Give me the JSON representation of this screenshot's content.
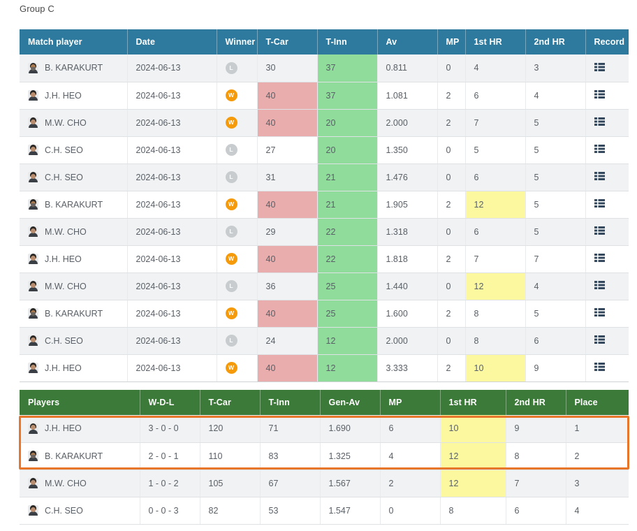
{
  "group_label": "Group C",
  "colors": {
    "match_header_bg": "#2d7a9e",
    "standings_header_bg": "#3b7a38",
    "green_cell": "#8fdc9b",
    "red_cell": "#eaadad",
    "yellow_cell": "#fbf8a0",
    "win_badge": "#f59b0b",
    "loss_badge": "#c8ccce",
    "highlight_border": "#e8762a"
  },
  "match_table": {
    "columns": [
      "Match player",
      "Date",
      "Winner",
      "T-Car",
      "T-Inn",
      "Av",
      "MP",
      "1st HR",
      "2nd HR",
      "Record"
    ],
    "rows": [
      {
        "player": "B. KARAKURT",
        "date": "2024-06-13",
        "winner": "L",
        "t_car": "30",
        "t_inn": "37",
        "av": "0.811",
        "mp": "0",
        "hr1": "4",
        "hr2": "3",
        "record": "record-list-icon"
      },
      {
        "player": "J.H. HEO",
        "date": "2024-06-13",
        "winner": "W",
        "t_car": "40",
        "t_inn": "37",
        "av": "1.081",
        "mp": "2",
        "hr1": "6",
        "hr2": "4",
        "record": "record-list-icon"
      },
      {
        "player": "M.W. CHO",
        "date": "2024-06-13",
        "winner": "W",
        "t_car": "40",
        "t_inn": "20",
        "av": "2.000",
        "mp": "2",
        "hr1": "7",
        "hr2": "5",
        "record": "record-list-icon"
      },
      {
        "player": "C.H. SEO",
        "date": "2024-06-13",
        "winner": "L",
        "t_car": "27",
        "t_inn": "20",
        "av": "1.350",
        "mp": "0",
        "hr1": "5",
        "hr2": "5",
        "record": "record-list-icon"
      },
      {
        "player": "C.H. SEO",
        "date": "2024-06-13",
        "winner": "L",
        "t_car": "31",
        "t_inn": "21",
        "av": "1.476",
        "mp": "0",
        "hr1": "6",
        "hr2": "5",
        "record": "record-list-icon"
      },
      {
        "player": "B. KARAKURT",
        "date": "2024-06-13",
        "winner": "W",
        "t_car": "40",
        "t_inn": "21",
        "av": "1.905",
        "mp": "2",
        "hr1": "12",
        "hr2": "5",
        "record": "record-list-icon"
      },
      {
        "player": "M.W. CHO",
        "date": "2024-06-13",
        "winner": "L",
        "t_car": "29",
        "t_inn": "22",
        "av": "1.318",
        "mp": "0",
        "hr1": "6",
        "hr2": "5",
        "record": "record-list-icon"
      },
      {
        "player": "J.H. HEO",
        "date": "2024-06-13",
        "winner": "W",
        "t_car": "40",
        "t_inn": "22",
        "av": "1.818",
        "mp": "2",
        "hr1": "7",
        "hr2": "7",
        "record": "record-list-icon"
      },
      {
        "player": "M.W. CHO",
        "date": "2024-06-13",
        "winner": "L",
        "t_car": "36",
        "t_inn": "25",
        "av": "1.440",
        "mp": "0",
        "hr1": "12",
        "hr2": "4",
        "record": "record-list-icon"
      },
      {
        "player": "B. KARAKURT",
        "date": "2024-06-13",
        "winner": "W",
        "t_car": "40",
        "t_inn": "25",
        "av": "1.600",
        "mp": "2",
        "hr1": "8",
        "hr2": "5",
        "record": "record-list-icon"
      },
      {
        "player": "C.H. SEO",
        "date": "2024-06-13",
        "winner": "L",
        "t_car": "24",
        "t_inn": "12",
        "av": "2.000",
        "mp": "0",
        "hr1": "8",
        "hr2": "6",
        "record": "record-list-icon"
      },
      {
        "player": "J.H. HEO",
        "date": "2024-06-13",
        "winner": "W",
        "t_car": "40",
        "t_inn": "12",
        "av": "3.333",
        "mp": "2",
        "hr1": "10",
        "hr2": "9",
        "record": "record-list-icon"
      }
    ]
  },
  "standings_table": {
    "columns": [
      "Players",
      "W-D-L",
      "T-Car",
      "T-Inn",
      "Gen-Av",
      "MP",
      "1st HR",
      "2nd HR",
      "Place"
    ],
    "rows": [
      {
        "player": "J.H. HEO",
        "wdl": "3 - 0 - 0",
        "t_car": "120",
        "t_inn": "71",
        "gen_av": "1.690",
        "mp": "6",
        "hr1": "10",
        "hr2": "9",
        "place": "1"
      },
      {
        "player": "B. KARAKURT",
        "wdl": "2 - 0 - 1",
        "t_car": "110",
        "t_inn": "83",
        "gen_av": "1.325",
        "mp": "4",
        "hr1": "12",
        "hr2": "8",
        "place": "2"
      },
      {
        "player": "M.W. CHO",
        "wdl": "1 - 0 - 2",
        "t_car": "105",
        "t_inn": "67",
        "gen_av": "1.567",
        "mp": "2",
        "hr1": "12",
        "hr2": "7",
        "place": "3"
      },
      {
        "player": "C.H. SEO",
        "wdl": "0 - 0 - 3",
        "t_car": "82",
        "t_inn": "53",
        "gen_av": "1.547",
        "mp": "0",
        "hr1": "8",
        "hr2": "6",
        "place": "4"
      }
    ]
  }
}
